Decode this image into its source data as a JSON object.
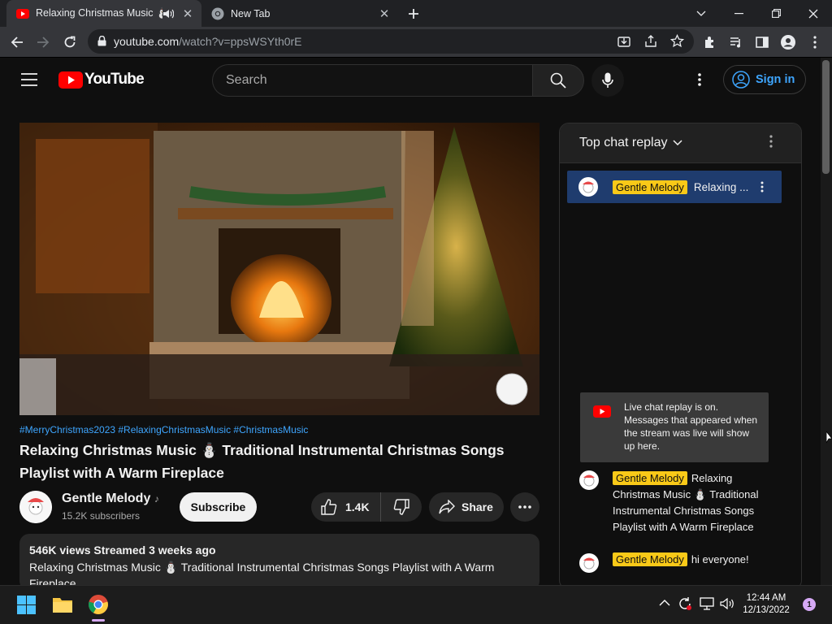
{
  "browser": {
    "tabs": [
      {
        "title": "Relaxing Christmas Music ⛄",
        "active": true
      },
      {
        "title": "New Tab",
        "active": false
      }
    ],
    "url_host": "youtube.com",
    "url_rest": "/watch?v=ppsWSYth0rE"
  },
  "youtube": {
    "logo_text": "YouTube",
    "search_placeholder": "Search",
    "sign_in_label": "Sign in"
  },
  "video": {
    "hashtags": "#MerryChristmas2023 #RelaxingChristmasMusic #ChristmasMusic",
    "title": "Relaxing Christmas Music ⛄ Traditional Instrumental Christmas Songs Playlist with A Warm Fireplace",
    "channel_name": "Gentle Melody",
    "channel_subscribers": "15.2K subscribers",
    "subscribe_label": "Subscribe",
    "likes": "1.4K",
    "share_label": "Share",
    "description": {
      "meta": "546K views  Streamed 3 weeks ago",
      "text": "Relaxing Christmas Music ⛄ Traditional Instrumental Christmas Songs Playlist with A Warm Fireplace"
    }
  },
  "chat": {
    "title": "Top chat replay",
    "pinned": {
      "author": "Gentle Melody",
      "text": "Relaxing ..."
    },
    "notice": "Live chat replay is on. Messages that appeared when the stream was live will show up here.",
    "messages": [
      {
        "author": "Gentle Melody",
        "text": "Relaxing Christmas Music ⛄ Traditional Instrumental Christmas Songs Playlist with A Warm Fireplace"
      },
      {
        "author": "Gentle Melody",
        "text": "hi everyone!"
      }
    ]
  },
  "taskbar": {
    "time": "12:44 AM",
    "date": "12/13/2022",
    "notification_count": "1"
  },
  "colors": {
    "youtube_red": "#ff0000",
    "link_blue": "#3ea6ff",
    "badge_yellow": "#f9c918",
    "pinned_blue": "#1f3c6e"
  }
}
